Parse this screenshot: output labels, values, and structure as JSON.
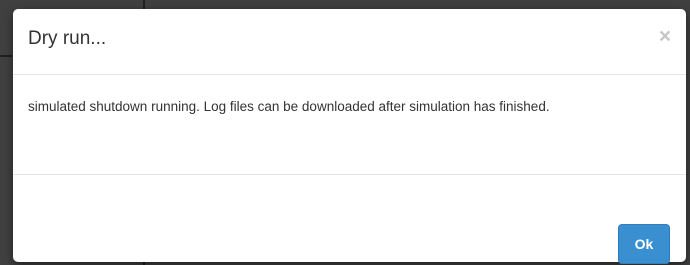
{
  "dialog": {
    "title": "Dry run...",
    "close_label": "×",
    "message": "simulated shutdown running. Log files can be downloaded after simulation has finished.",
    "ok_label": "Ok"
  },
  "colors": {
    "primary_button": "#3a8fd1",
    "backdrop": "#404040",
    "text": "#333333"
  }
}
